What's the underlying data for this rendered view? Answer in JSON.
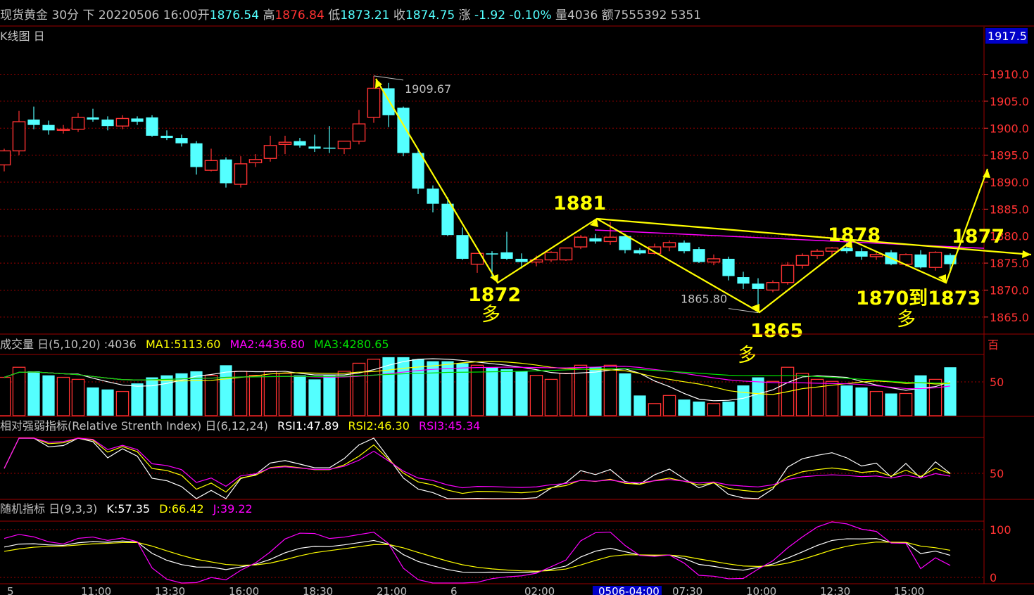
{
  "header": {
    "label": "现货黄金 30分 下 20220506 16:00",
    "open_label": "开",
    "open": "1876.54",
    "high_label": "高",
    "high": "1876.84",
    "low_label": "低",
    "low": "1873.21",
    "close_label": "收",
    "close": "1874.75",
    "change_label": "涨",
    "change": "-1.92",
    "change_pct": "-0.10%",
    "volume_label": "量",
    "volume": "4036",
    "amount_label": "额",
    "amount": "7555392 5351"
  },
  "kline_panel": {
    "title": "K线图 日",
    "price_badge": "1917.5",
    "y_ticks": [
      "1910.0",
      "1905.0",
      "1900.0",
      "1895.0",
      "1890.0",
      "1885.0",
      "1880.0",
      "1875.0",
      "1870.0",
      "1865.0"
    ],
    "marks": {
      "high": "1909.67",
      "low": "1865.80"
    }
  },
  "volume_panel": {
    "title": "成交量 日(5,10,20) :4036",
    "ma1": "MA1:5113.60",
    "ma2": "MA2:4436.80",
    "ma3": "MA3:4280.65",
    "right_label": "百",
    "tick": "50"
  },
  "rsi_panel": {
    "title": "相对强弱指标(Relative Strenth Index) 日(6,12,24)",
    "rsi1": "RSI1:47.89",
    "rsi2": "RSI2:46.30",
    "rsi3": "RSI3:45.34",
    "tick": "50"
  },
  "kdj_panel": {
    "title": "随机指标 日(9,3,3)",
    "k": "K:57.35",
    "d": "D:66.42",
    "j": "J:39.22",
    "ticks": [
      "100",
      "0"
    ]
  },
  "annotations": [
    {
      "text": "1881"
    },
    {
      "text": "1872"
    },
    {
      "text": "多"
    },
    {
      "text": "1878"
    },
    {
      "text": "1877"
    },
    {
      "text": "1865"
    },
    {
      "text": "多"
    },
    {
      "text": "1870到1873"
    },
    {
      "text": "多"
    }
  ],
  "time_axis": [
    "5",
    "11:00",
    "13:30",
    "16:00",
    "18:30",
    "21:00",
    "6",
    "02:00",
    "0506-04:00",
    "07:30",
    "10:00",
    "12:30",
    "15:00"
  ],
  "colors": {
    "up": "#ff3232",
    "down": "#54ffff",
    "grid": "#9b0000",
    "ma1": "#ffffff",
    "ma2": "#ffff00",
    "ma3": "#ff00ff",
    "ma4": "#00e000",
    "annotation": "#ffff00"
  },
  "chart_data": {
    "type": "candlestick",
    "interval": "30分",
    "ylim": [
      1862.5,
      1917.5
    ],
    "candles": [
      {
        "o": 1893.2,
        "h": 1896.2,
        "l": 1892.0,
        "c": 1895.8
      },
      {
        "o": 1895.8,
        "h": 1903.2,
        "l": 1895.0,
        "c": 1901.2
      },
      {
        "o": 1901.6,
        "h": 1904.0,
        "l": 1899.8,
        "c": 1900.6
      },
      {
        "o": 1900.6,
        "h": 1901.4,
        "l": 1898.8,
        "c": 1899.6
      },
      {
        "o": 1899.6,
        "h": 1900.6,
        "l": 1899.0,
        "c": 1899.8
      },
      {
        "o": 1899.8,
        "h": 1902.8,
        "l": 1899.3,
        "c": 1902.0
      },
      {
        "o": 1902.0,
        "h": 1903.6,
        "l": 1901.2,
        "c": 1901.6
      },
      {
        "o": 1901.6,
        "h": 1902.2,
        "l": 1899.6,
        "c": 1900.4
      },
      {
        "o": 1900.4,
        "h": 1902.4,
        "l": 1899.8,
        "c": 1901.8
      },
      {
        "o": 1901.8,
        "h": 1902.2,
        "l": 1900.6,
        "c": 1901.2
      },
      {
        "o": 1902.0,
        "h": 1902.4,
        "l": 1898.4,
        "c": 1898.6
      },
      {
        "o": 1898.6,
        "h": 1899.6,
        "l": 1897.8,
        "c": 1898.2
      },
      {
        "o": 1898.2,
        "h": 1898.8,
        "l": 1896.6,
        "c": 1897.2
      },
      {
        "o": 1897.2,
        "h": 1897.6,
        "l": 1891.4,
        "c": 1892.8
      },
      {
        "o": 1892.2,
        "h": 1896.2,
        "l": 1892.0,
        "c": 1894.0
      },
      {
        "o": 1894.2,
        "h": 1894.6,
        "l": 1889.0,
        "c": 1889.8
      },
      {
        "o": 1889.6,
        "h": 1894.8,
        "l": 1889.0,
        "c": 1893.4
      },
      {
        "o": 1893.6,
        "h": 1895.2,
        "l": 1892.8,
        "c": 1894.2
      },
      {
        "o": 1894.4,
        "h": 1898.6,
        "l": 1893.8,
        "c": 1896.8
      },
      {
        "o": 1897.0,
        "h": 1898.6,
        "l": 1895.2,
        "c": 1897.4
      },
      {
        "o": 1897.6,
        "h": 1898.2,
        "l": 1896.4,
        "c": 1896.8
      },
      {
        "o": 1896.6,
        "h": 1898.8,
        "l": 1895.6,
        "c": 1896.2
      },
      {
        "o": 1896.4,
        "h": 1900.4,
        "l": 1895.4,
        "c": 1896.2
      },
      {
        "o": 1896.2,
        "h": 1897.6,
        "l": 1895.2,
        "c": 1897.6
      },
      {
        "o": 1897.6,
        "h": 1903.4,
        "l": 1897.0,
        "c": 1900.8
      },
      {
        "o": 1902.0,
        "h": 1909.7,
        "l": 1901.0,
        "c": 1907.4
      },
      {
        "o": 1907.4,
        "h": 1908.4,
        "l": 1900.2,
        "c": 1902.4
      },
      {
        "o": 1903.8,
        "h": 1904.0,
        "l": 1894.8,
        "c": 1895.4
      },
      {
        "o": 1895.4,
        "h": 1896.0,
        "l": 1887.8,
        "c": 1888.8
      },
      {
        "o": 1888.8,
        "h": 1889.4,
        "l": 1884.4,
        "c": 1886.0
      },
      {
        "o": 1886.0,
        "h": 1887.2,
        "l": 1880.0,
        "c": 1880.2
      },
      {
        "o": 1880.2,
        "h": 1881.6,
        "l": 1875.6,
        "c": 1875.8
      },
      {
        "o": 1874.8,
        "h": 1876.8,
        "l": 1873.2,
        "c": 1876.8
      },
      {
        "o": 1876.8,
        "h": 1877.2,
        "l": 1872.2,
        "c": 1876.6
      },
      {
        "o": 1877.0,
        "h": 1880.8,
        "l": 1875.6,
        "c": 1875.8
      },
      {
        "o": 1875.8,
        "h": 1876.8,
        "l": 1874.0,
        "c": 1875.2
      },
      {
        "o": 1875.2,
        "h": 1876.4,
        "l": 1874.4,
        "c": 1875.6
      },
      {
        "o": 1875.6,
        "h": 1877.2,
        "l": 1875.2,
        "c": 1877.0
      },
      {
        "o": 1875.6,
        "h": 1877.8,
        "l": 1875.4,
        "c": 1877.8
      },
      {
        "o": 1878.0,
        "h": 1880.2,
        "l": 1877.6,
        "c": 1879.8
      },
      {
        "o": 1879.6,
        "h": 1880.4,
        "l": 1878.6,
        "c": 1879.0
      },
      {
        "o": 1879.0,
        "h": 1882.6,
        "l": 1878.4,
        "c": 1879.8
      },
      {
        "o": 1880.0,
        "h": 1880.4,
        "l": 1876.8,
        "c": 1877.4
      },
      {
        "o": 1877.4,
        "h": 1877.8,
        "l": 1876.6,
        "c": 1876.8
      },
      {
        "o": 1876.8,
        "h": 1878.6,
        "l": 1876.6,
        "c": 1878.0
      },
      {
        "o": 1878.0,
        "h": 1879.2,
        "l": 1877.2,
        "c": 1878.8
      },
      {
        "o": 1878.8,
        "h": 1879.2,
        "l": 1876.8,
        "c": 1877.2
      },
      {
        "o": 1877.6,
        "h": 1878.0,
        "l": 1875.0,
        "c": 1875.2
      },
      {
        "o": 1875.2,
        "h": 1876.6,
        "l": 1874.6,
        "c": 1875.8
      },
      {
        "o": 1875.8,
        "h": 1876.2,
        "l": 1871.8,
        "c": 1872.6
      },
      {
        "o": 1872.4,
        "h": 1873.4,
        "l": 1870.2,
        "c": 1871.2
      },
      {
        "o": 1871.2,
        "h": 1872.2,
        "l": 1865.8,
        "c": 1870.2
      },
      {
        "o": 1870.0,
        "h": 1871.8,
        "l": 1869.6,
        "c": 1871.4
      },
      {
        "o": 1871.4,
        "h": 1875.2,
        "l": 1871.0,
        "c": 1874.6
      },
      {
        "o": 1874.6,
        "h": 1876.8,
        "l": 1874.0,
        "c": 1876.4
      },
      {
        "o": 1876.4,
        "h": 1877.6,
        "l": 1875.8,
        "c": 1877.2
      },
      {
        "o": 1877.2,
        "h": 1878.0,
        "l": 1876.2,
        "c": 1877.8
      },
      {
        "o": 1877.8,
        "h": 1878.8,
        "l": 1876.8,
        "c": 1877.2
      },
      {
        "o": 1877.2,
        "h": 1877.8,
        "l": 1875.6,
        "c": 1876.2
      },
      {
        "o": 1876.2,
        "h": 1877.2,
        "l": 1875.6,
        "c": 1876.6
      },
      {
        "o": 1877.0,
        "h": 1877.4,
        "l": 1874.6,
        "c": 1874.8
      },
      {
        "o": 1874.8,
        "h": 1876.8,
        "l": 1874.4,
        "c": 1876.6
      },
      {
        "o": 1876.6,
        "h": 1877.4,
        "l": 1874.0,
        "c": 1874.2
      },
      {
        "o": 1874.2,
        "h": 1877.2,
        "l": 1873.6,
        "c": 1877.0
      },
      {
        "o": 1876.5,
        "h": 1876.8,
        "l": 1873.2,
        "c": 1874.8
      }
    ],
    "volume": [
      38,
      48,
      44,
      40,
      38,
      36,
      28,
      26,
      24,
      32,
      38,
      40,
      42,
      44,
      40,
      50,
      44,
      40,
      44,
      42,
      40,
      36,
      40,
      44,
      52,
      56,
      58,
      58,
      56,
      54,
      54,
      52,
      50,
      48,
      46,
      44,
      40,
      36,
      42,
      50,
      48,
      50,
      42,
      20,
      12,
      20,
      16,
      14,
      12,
      14,
      30,
      38,
      34,
      48,
      42,
      36,
      34,
      30,
      28,
      24,
      22,
      22,
      40,
      36,
      48,
      52,
      26
    ],
    "rsi_range": [
      0,
      100
    ],
    "kdj_range": [
      0,
      100
    ]
  }
}
